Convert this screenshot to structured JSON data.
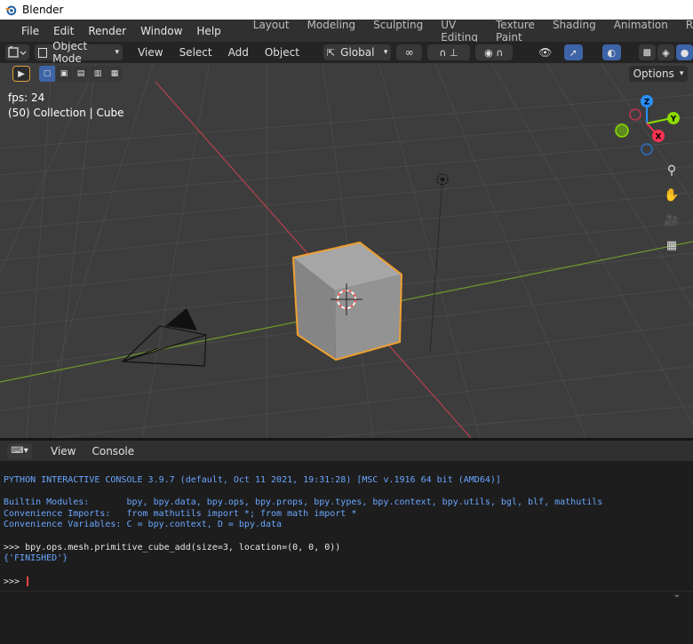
{
  "window": {
    "title": "Blender"
  },
  "menu": [
    "File",
    "Edit",
    "Render",
    "Window",
    "Help"
  ],
  "workspaces": [
    "Layout",
    "Modeling",
    "Sculpting",
    "UV Editing",
    "Texture Paint",
    "Shading",
    "Animation",
    "Renderi"
  ],
  "viewport_header": {
    "mode": "Object Mode",
    "menus": [
      "View",
      "Select",
      "Add",
      "Object"
    ],
    "transform_orientation": "Global",
    "options_label": "Options"
  },
  "viewport_overlay": {
    "fps": "fps: 24",
    "info": "(50) Collection | Cube"
  },
  "gizmo": {
    "x": "X",
    "y": "Y",
    "z": "Z"
  },
  "console_header": {
    "menus": [
      "View",
      "Console"
    ]
  },
  "console": {
    "lines": [
      "PYTHON INTERACTIVE CONSOLE 3.9.7 (default, Oct 11 2021, 19:31:28) [MSC v.1916 64 bit (AMD64)]",
      "Builtin Modules:       bpy, bpy.data, bpy.ops, bpy.props, bpy.types, bpy.context, bpy.utils, bgl, blf, mathutils",
      "Convenience Imports:   from mathutils import *; from math import *",
      "Convenience Variables: C = bpy.context, D = bpy.data",
      ">>> bpy.ops.mesh.primitive_cube_add(size=3, location=(0, 0, 0))",
      "{'FINISHED'}",
      ">>> "
    ]
  },
  "colors": {
    "accent": "#3e64a8",
    "selection_outline": "#f0a030",
    "x_axis": "#ff3352",
    "y_axis": "#8bdc00",
    "z_axis": "#2890ff"
  }
}
